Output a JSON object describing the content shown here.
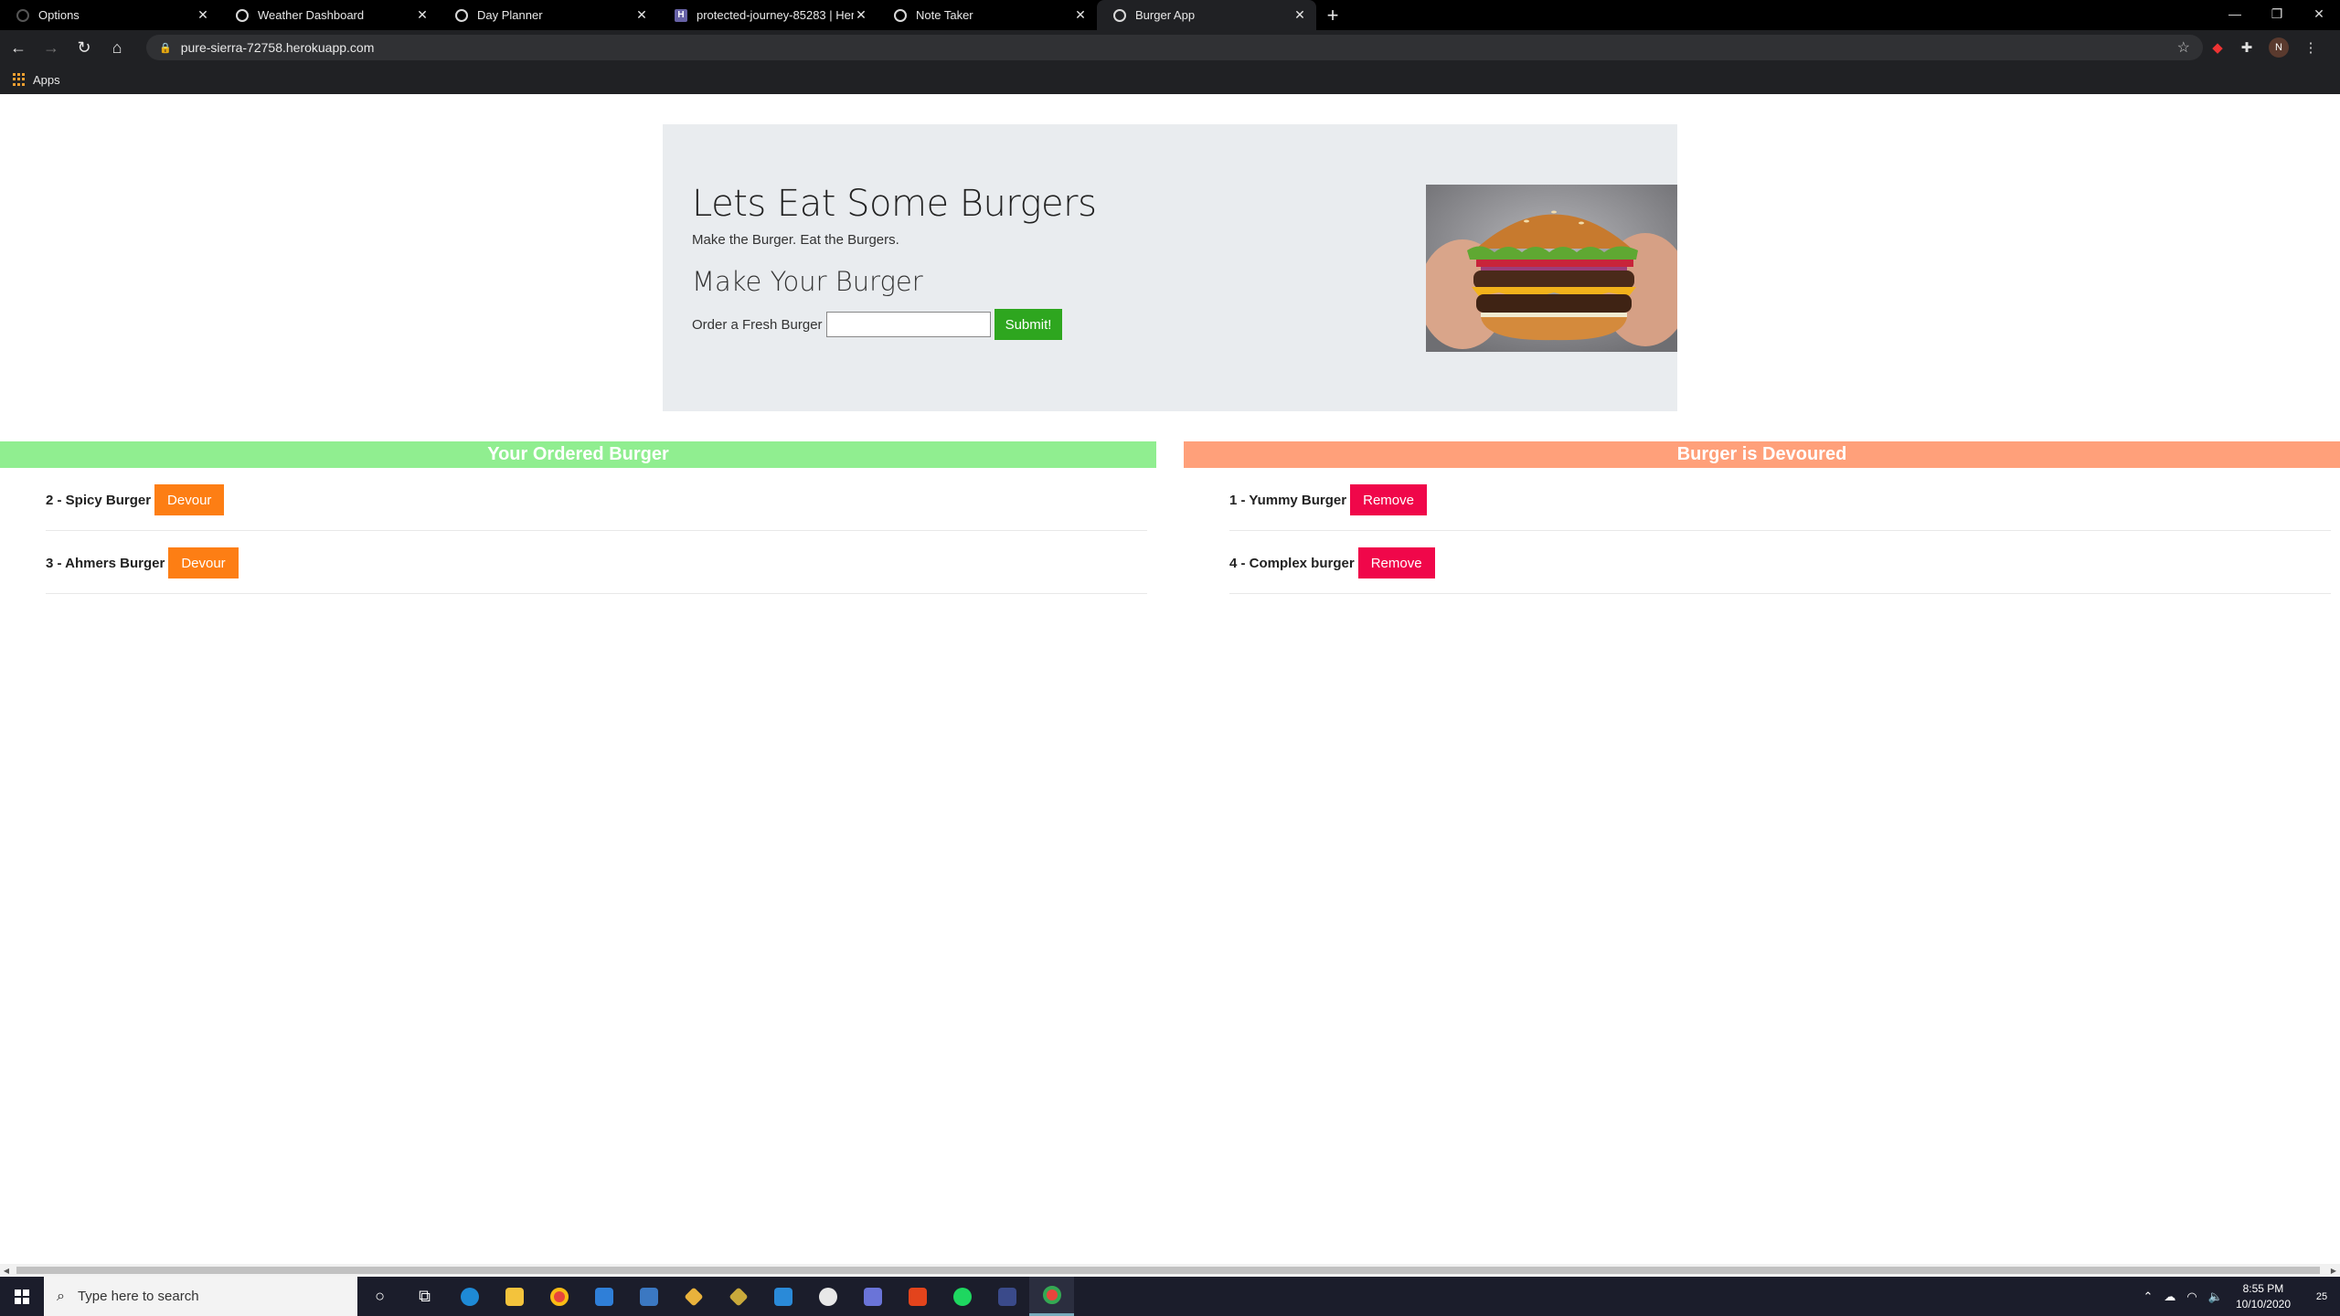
{
  "browser": {
    "tabs": [
      {
        "title": "Options",
        "icon": "loading-icon"
      },
      {
        "title": "Weather Dashboard",
        "icon": "globe-icon"
      },
      {
        "title": "Day Planner",
        "icon": "globe-icon"
      },
      {
        "title": "protected-journey-85283 | Herol",
        "icon": "heroku-icon"
      },
      {
        "title": "Note Taker",
        "icon": "globe-icon"
      },
      {
        "title": "Burger App",
        "icon": "globe-icon"
      }
    ],
    "url": "pure-sierra-72758.herokuapp.com",
    "bookmarks": {
      "apps_label": "Apps"
    },
    "profile_initial": "N"
  },
  "jumbotron": {
    "title": "Lets Eat Some Burgers",
    "lead": "Make the Burger. Eat the Burgers.",
    "subtitle": "Make Your Burger",
    "order_label": "Order a Fresh Burger",
    "order_value": "",
    "submit_label": "Submit!"
  },
  "ordered": {
    "header": "Your Ordered Burger",
    "button_label": "Devour",
    "items": [
      {
        "name": "2 - Spicy Burger"
      },
      {
        "name": "3 - Ahmers Burger"
      }
    ]
  },
  "devoured": {
    "header": "Burger is Devoured",
    "button_label": "Remove",
    "items": [
      {
        "name": "1 - Yummy Burger"
      },
      {
        "name": "4 - Complex burger"
      }
    ]
  },
  "taskbar": {
    "search_placeholder": "Type here to search",
    "time": "8:55 PM",
    "date": "10/10/2020",
    "notifications": "25"
  },
  "colors": {
    "ordered_header": "#90ee90",
    "devoured_header": "#ffa07a",
    "submit": "#2ea61f",
    "devour": "#fd7e14",
    "remove": "#f0074a"
  }
}
